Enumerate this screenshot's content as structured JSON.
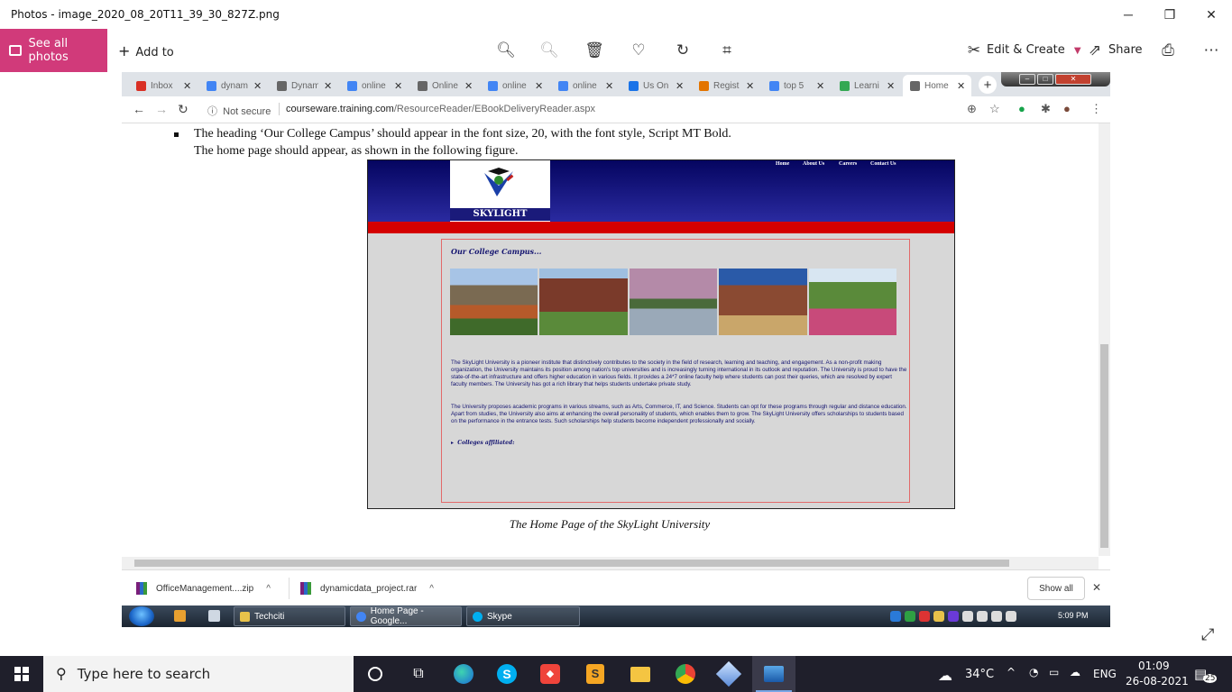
{
  "photos_app": {
    "title": "Photos - image_2020_08_20T11_39_30_827Z.png",
    "see_all": "See all photos",
    "add_to": "Add to",
    "edit_create": "Edit & Create",
    "share": "Share",
    "controls": {
      "minimize": "─",
      "maximize": "❐",
      "close": "✕"
    }
  },
  "browser": {
    "tabs": [
      {
        "label": "Inbox",
        "favicon_color": "#d93025"
      },
      {
        "label": "dynam",
        "favicon_color": "#4285f4"
      },
      {
        "label": "Dynam",
        "favicon_color": "#666666"
      },
      {
        "label": "online",
        "favicon_color": "#4285f4"
      },
      {
        "label": "Online",
        "favicon_color": "#666666"
      },
      {
        "label": "online",
        "favicon_color": "#4285f4"
      },
      {
        "label": "online",
        "favicon_color": "#4285f4"
      },
      {
        "label": "Us On",
        "favicon_color": "#1a73e8"
      },
      {
        "label": "Regist",
        "favicon_color": "#e37400"
      },
      {
        "label": "top 5",
        "favicon_color": "#4285f4"
      },
      {
        "label": "Learni",
        "favicon_color": "#34a853"
      },
      {
        "label": "Home",
        "favicon_color": "#666666",
        "active": true
      }
    ],
    "security": "Not secure",
    "url_host": "courseware.training.com",
    "url_path": "/ResourceReader/EBookDeliveryReader.aspx"
  },
  "document": {
    "bullet_text": "The heading ‘Our College Campus’ should appear in the font size, 20, with the font style, Script MT Bold.",
    "line2": "The home page should appear, as shown in the following figure.",
    "caption": "The Home Page of the SkyLight University",
    "figure": {
      "nav": [
        "Home",
        "About Us",
        "Careers",
        "Contact Us"
      ],
      "logo_text": "SKYLIGHT UNIVERSITY",
      "heading": "Our College Campus...",
      "para1": "The SkyLight University is a pioneer institute that distinctively contributes to the society in the field of research, learning and teaching, and engagement. As a non-profit making organization, the University maintains its position among nation's top universities and is increasingly turning international in its outlook and reputation. The University is proud to have the state-of-the-art infrastructure and offers higher education in various fields. It provides a 24*7 online faculty help where students can post their queries, which are resolved by expert faculty members. The University has got a rich library that helps students undertake private study.",
      "para2": "The University proposes academic programs in various streams, such as Arts, Commerce, IT, and Science. Students can opt for these programs through regular and distance education. Apart from studies, the University also aims at enhancing the overall personality of students, which enables them to grow. The SkyLight University offers scholarships to students based on the performance in the entrance tests. Such scholarships help students become independent professionally and socially.",
      "affiliated": "Colleges affiliated:"
    }
  },
  "downloads": {
    "items": [
      {
        "name": "OfficeManagement....zip"
      },
      {
        "name": "dynamicdata_project.rar"
      }
    ],
    "show_all": "Show all"
  },
  "win7_taskbar": {
    "tasks": [
      {
        "label": "Techciti",
        "color": "#e8c24a"
      },
      {
        "label": "Home Page - Google...",
        "color": "#4285f4"
      },
      {
        "label": "Skype",
        "color": "#00aff0"
      }
    ],
    "clock": "5:09 PM"
  },
  "taskbar": {
    "search_placeholder": "Type here to search",
    "weather": "34°C",
    "language": "ENG",
    "time": "01:09",
    "date": "26-08-2021",
    "notifications": "25"
  }
}
